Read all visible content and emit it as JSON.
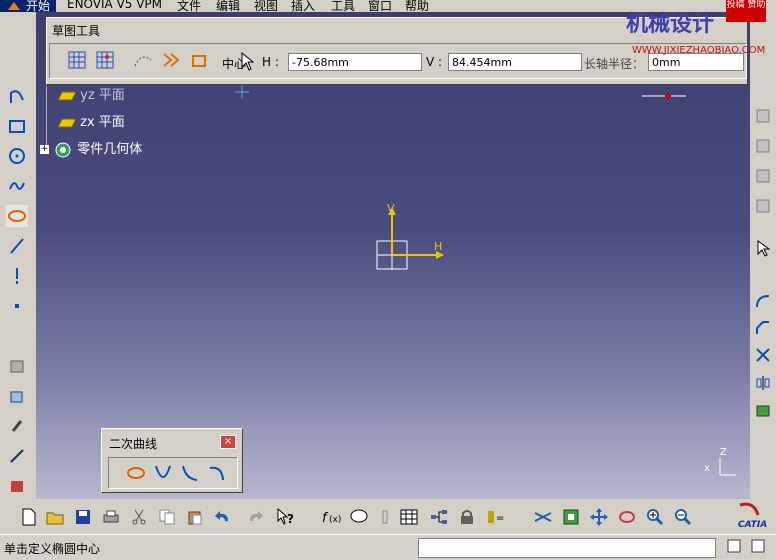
{
  "menubar": {
    "start": "开始",
    "items": [
      "ENOVIA V5 VPM",
      "文件",
      "编辑",
      "视图",
      "插入",
      "工具",
      "窗口",
      "帮助"
    ]
  },
  "sketch_tools": {
    "title": "草图工具",
    "center_label": "中心",
    "h_label": "H :",
    "h_value": "-75.68mm",
    "v_label": "V :",
    "v_value": "84.454mm",
    "major_radius_label": "长轴半径：",
    "major_radius_value": "0mm"
  },
  "tree": {
    "yz_plane": "yz 平面",
    "zx_plane": "zx 平面",
    "part_geometry": "零件几何体"
  },
  "axes": {
    "v": "V",
    "h": "H",
    "z": "Z",
    "x": "x"
  },
  "conic_toolbar": {
    "title": "二次曲线"
  },
  "status": {
    "message": "单击定义椭圆中心"
  },
  "watermark": {
    "cn": "机械设计",
    "url": "WWW.JIXIEZHAOBIAO.COM",
    "badge": "投稿 赞助"
  },
  "colors": {
    "viewport_top": "#3c3e70",
    "viewport_bottom": "#b8b8d0",
    "axis": "#e8c800"
  }
}
